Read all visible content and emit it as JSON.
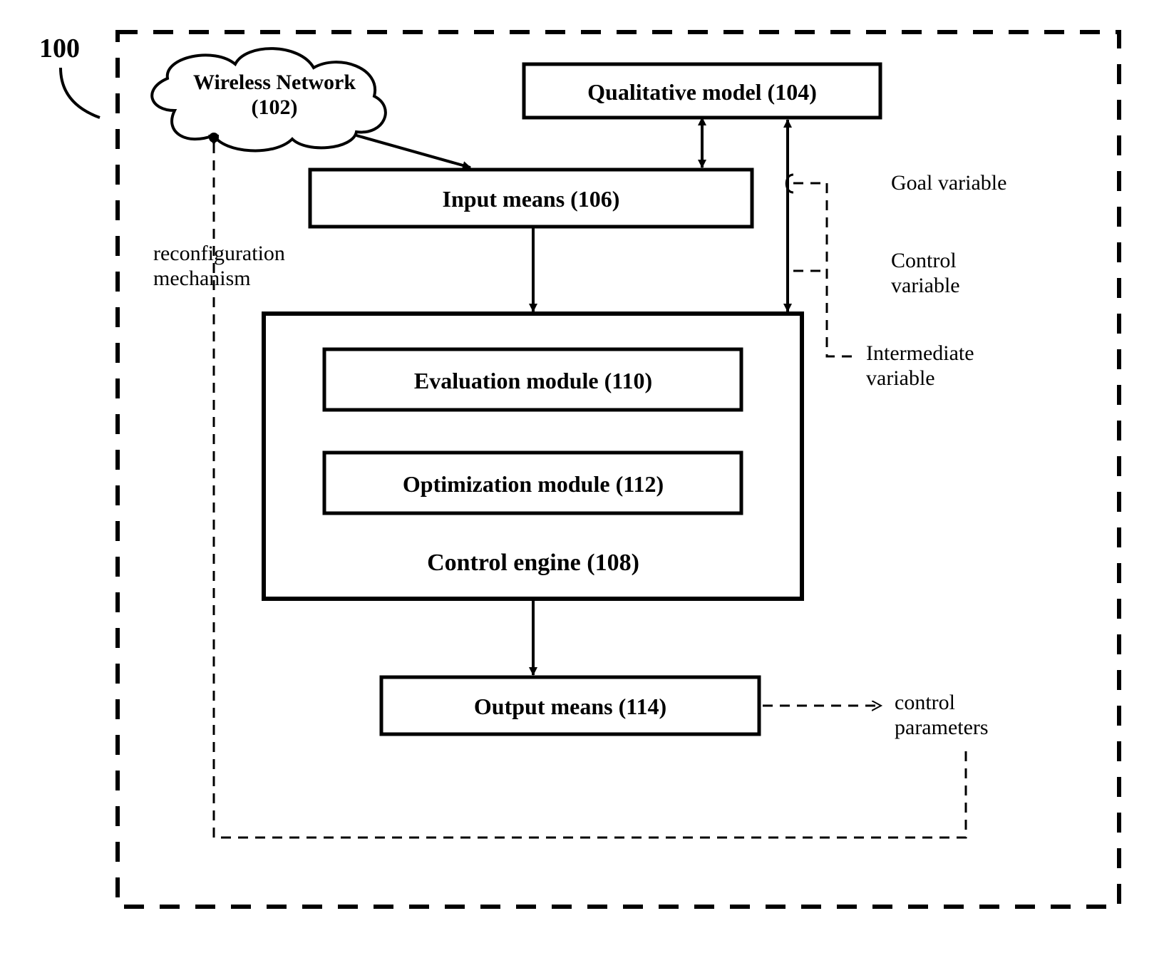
{
  "figure_id": "100",
  "blocks": {
    "wireless_network": {
      "line1": "Wireless Network",
      "line2": "(102)"
    },
    "qualitative_model": "Qualitative model (104)",
    "input_means": "Input means (106)",
    "control_engine_title": "Control engine (108)",
    "evaluation_module": "Evaluation module (110)",
    "optimization_module": "Optimization module (112)",
    "output_means": "Output means (114)"
  },
  "annotations": {
    "reconfiguration_line1": "reconfiguration",
    "reconfiguration_line2": "mechanism",
    "goal_variable": "Goal variable",
    "control_variable_line1": "Control",
    "control_variable_line2": "variable",
    "intermediate_line1": "Intermediate",
    "intermediate_line2": "variable",
    "control_params_line1": "control",
    "control_params_line2": "parameters"
  }
}
